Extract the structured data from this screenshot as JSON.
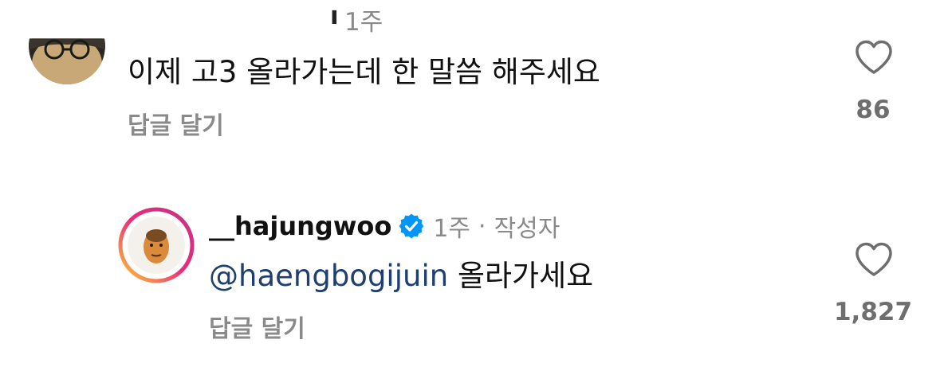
{
  "comments": [
    {
      "username_fragment": "ı",
      "time": "1주",
      "text": "이제 고3 올라가는데 한 말씀 해주세요",
      "reply_label": "답글 달기",
      "likes": "86",
      "avatar_icon": "user-avatar-glasses-icon",
      "heart_icon": "heart-outline-icon"
    },
    {
      "username": "__hajungwoo",
      "verified_icon": "verified-badge-icon",
      "time": "1주",
      "separator": "·",
      "author_tag": "작성자",
      "mention": "@haengbogijuin",
      "text": "올라가세요",
      "reply_label": "답글 달기",
      "likes": "1,827",
      "avatar_icon": "story-ring-avatar-icon",
      "heart_icon": "heart-outline-icon"
    }
  ],
  "colors": {
    "verified_blue": "#0095f6",
    "mention": "#1f3f6e",
    "secondary_text": "#8a8a8a",
    "likes_text": "#6e6e6e",
    "story_ring_start": "#f9ce34",
    "story_ring_mid": "#ee2a7b",
    "story_ring_end": "#6228d7"
  }
}
